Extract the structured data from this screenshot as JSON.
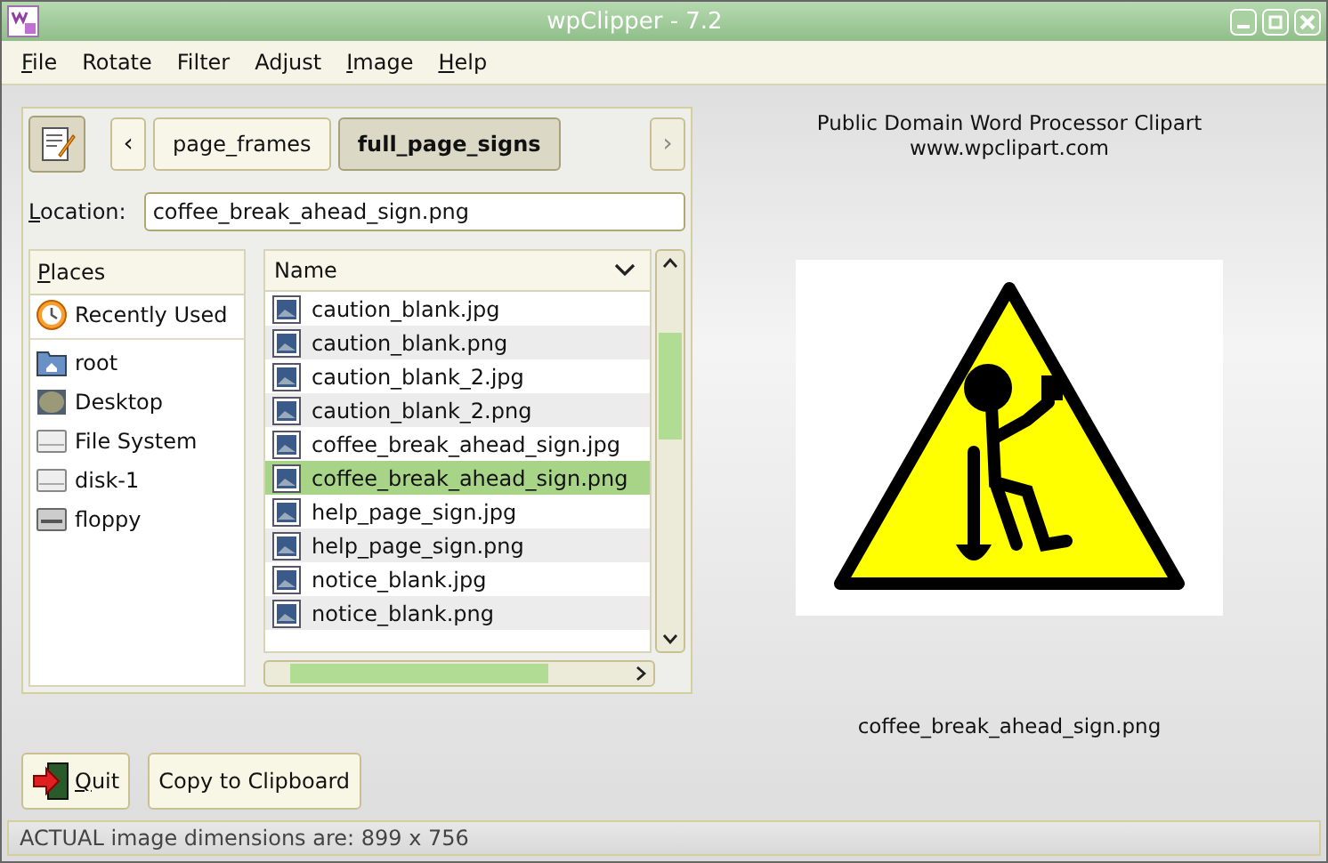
{
  "window": {
    "title": "wpClipper - 7.2"
  },
  "menu": [
    {
      "label": "File",
      "underline_first": true
    },
    {
      "label": "Rotate",
      "underline_first": false
    },
    {
      "label": "Filter",
      "underline_first": false
    },
    {
      "label": "Adjust",
      "underline_first": false
    },
    {
      "label": "Image",
      "underline_first": true
    },
    {
      "label": "Help",
      "underline_first": true
    }
  ],
  "path_bar": {
    "back": "‹",
    "forward": "›",
    "forward_disabled": true,
    "crumbs": [
      {
        "label": "page_frames",
        "selected": false
      },
      {
        "label": "full_page_signs",
        "selected": true
      }
    ]
  },
  "location": {
    "label": "Location:",
    "value": "coffee_break_ahead_sign.png"
  },
  "places": {
    "heading": "Places",
    "items": [
      {
        "label": "Recently Used",
        "kind": "recent"
      },
      {
        "label": "root",
        "kind": "folder"
      },
      {
        "label": "Desktop",
        "kind": "desktop"
      },
      {
        "label": "File System",
        "kind": "drive"
      },
      {
        "label": "disk-1",
        "kind": "drive"
      },
      {
        "label": "floppy",
        "kind": "floppy"
      }
    ]
  },
  "files": {
    "heading": "Name",
    "rows": [
      {
        "name": "caution_blank.jpg",
        "selected": false
      },
      {
        "name": "caution_blank.png",
        "selected": false
      },
      {
        "name": "caution_blank_2.jpg",
        "selected": false
      },
      {
        "name": "caution_blank_2.png",
        "selected": false
      },
      {
        "name": "coffee_break_ahead_sign.jpg",
        "selected": false
      },
      {
        "name": "coffee_break_ahead_sign.png",
        "selected": true
      },
      {
        "name": "help_page_sign.jpg",
        "selected": false
      },
      {
        "name": "help_page_sign.png",
        "selected": false
      },
      {
        "name": "notice_blank.jpg",
        "selected": false
      },
      {
        "name": "notice_blank.png",
        "selected": false
      }
    ]
  },
  "preview": {
    "heading": "Public Domain Word Processor Clipart",
    "url": "www.wpclipart.com",
    "caption": "coffee_break_ahead_sign.png"
  },
  "buttons": {
    "quit": "Quit",
    "copy": "Copy to Clipboard"
  },
  "status_bar": "ACTUAL image dimensions are: 899 x 756"
}
